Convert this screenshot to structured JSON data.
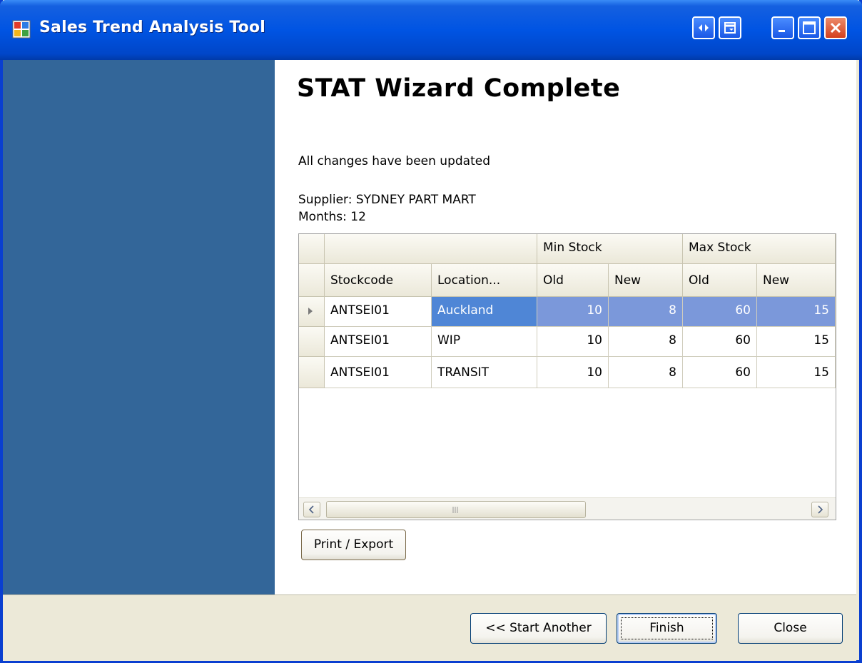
{
  "window": {
    "title": "Sales Trend Analysis Tool",
    "controls": [
      "restore-left-right",
      "tile",
      "minimize",
      "maximize",
      "close"
    ]
  },
  "page": {
    "heading": "STAT Wizard Complete",
    "status_message": "All changes have been updated",
    "supplier_line": "Supplier: SYDNEY PART MART",
    "months_line": "Months: 12"
  },
  "grid": {
    "group_headers": {
      "min_stock": "Min Stock",
      "max_stock": "Max Stock"
    },
    "columns": {
      "stockcode": "Stockcode",
      "location": "Location...",
      "min_old": "Old",
      "min_new": "New",
      "max_old": "Old",
      "max_new": "New"
    },
    "rows": [
      {
        "stockcode": "ANTSEI01",
        "location": "Auckland",
        "min_old": "10",
        "min_new": "8",
        "max_old": "60",
        "max_new": "15",
        "selected": true
      },
      {
        "stockcode": "ANTSEI01",
        "location": "WIP",
        "min_old": "10",
        "min_new": "8",
        "max_old": "60",
        "max_new": "15",
        "selected": false
      },
      {
        "stockcode": "ANTSEI01",
        "location": "TRANSIT",
        "min_old": "10",
        "min_new": "8",
        "max_old": "60",
        "max_new": "15",
        "selected": false
      }
    ],
    "selection_color": "#7b98da"
  },
  "buttons": {
    "print_export": "Print / Export",
    "start_another": "<< Start Another",
    "finish": "Finish",
    "close": "Close"
  },
  "colors": {
    "side_panel": "#336699",
    "titlebar": "#0054e3"
  }
}
